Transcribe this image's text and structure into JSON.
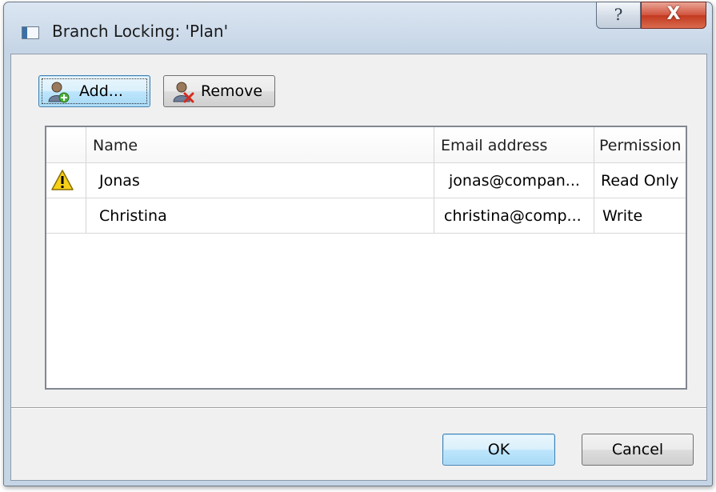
{
  "window": {
    "title": "Branch Locking: 'Plan'",
    "help_label": "?",
    "close_label": "X"
  },
  "toolbar": {
    "add_label": "Add...",
    "add_icon": "user-add-icon",
    "remove_label": "Remove",
    "remove_icon": "user-remove-icon"
  },
  "table": {
    "columns": [
      "",
      "Name",
      "Email address",
      "Permission"
    ],
    "rows": [
      {
        "status_icon": "warning-icon",
        "name": "Jonas",
        "email": "jonas@compan...",
        "permission": "Read Only"
      },
      {
        "status_icon": "",
        "name": "Christina",
        "email": "christina@comp...",
        "permission": "Write"
      }
    ]
  },
  "footer": {
    "ok_label": "OK",
    "cancel_label": "Cancel"
  },
  "colors": {
    "title_bg": "#dbe6f2",
    "close_red": "#c2391f",
    "focus_blue": "#3c7fb1",
    "warning_yellow": "#f7d117"
  }
}
